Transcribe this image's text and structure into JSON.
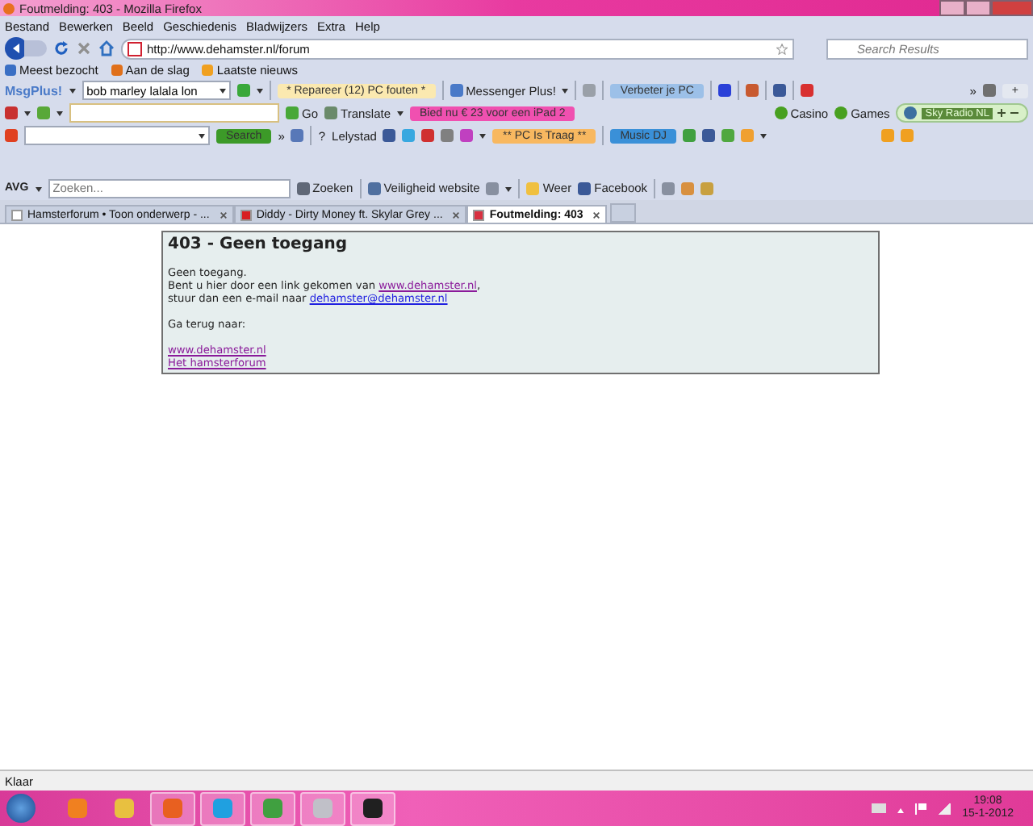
{
  "window": {
    "title": "Foutmelding: 403 - Mozilla Firefox"
  },
  "menu": [
    "Bestand",
    "Bewerken",
    "Beeld",
    "Geschiedenis",
    "Bladwijzers",
    "Extra",
    "Help"
  ],
  "navigation": {
    "url": "http://www.dehamster.nl/forum",
    "search_placeholder": "Search Results"
  },
  "bookmarks": [
    {
      "label": "Meest bezocht",
      "color": "#3a6fc4"
    },
    {
      "label": "Aan de slag",
      "color": "#e0701a"
    },
    {
      "label": "Laatste nieuws",
      "color": "#f0a020"
    }
  ],
  "toolbars": [
    {
      "left": [
        {
          "kind": "logo",
          "label": "MsgPlus!"
        },
        {
          "kind": "caret"
        },
        {
          "kind": "field",
          "value": "bob marley lalala lon",
          "dropdown": true
        },
        {
          "kind": "icon",
          "color": "#3aa83a"
        },
        {
          "kind": "caret"
        },
        {
          "kind": "separator"
        },
        {
          "kind": "promo",
          "label": "* Repareer (12) PC fouten *",
          "color": "#fbe9b0"
        },
        {
          "kind": "separator"
        },
        {
          "kind": "label",
          "label": "Messenger Plus!",
          "color": "#4a7ac8"
        },
        {
          "kind": "caret"
        },
        {
          "kind": "separator"
        },
        {
          "kind": "icon",
          "color": "#9aa0a8"
        },
        {
          "kind": "separator"
        },
        {
          "kind": "promo",
          "label": "Verbeter je PC",
          "color": "#9cc0e8"
        },
        {
          "kind": "separator"
        },
        {
          "kind": "icon",
          "color": "#2a40d8"
        },
        {
          "kind": "separator"
        },
        {
          "kind": "icon",
          "color": "#c85a30"
        },
        {
          "kind": "separator"
        },
        {
          "kind": "icon",
          "color": "#3b5998"
        },
        {
          "kind": "separator"
        },
        {
          "kind": "icon",
          "color": "#d83030"
        }
      ],
      "right": [
        {
          "kind": "label",
          "label": "»"
        },
        {
          "kind": "icon",
          "color": "#707070"
        },
        {
          "kind": "promo",
          "label": "+",
          "color": "#e4e8f0"
        }
      ]
    },
    {
      "left": [
        {
          "kind": "icon",
          "color": "#c83030"
        },
        {
          "kind": "caret"
        },
        {
          "kind": "icon",
          "color": "#58a838"
        },
        {
          "kind": "caret"
        },
        {
          "kind": "field"
        },
        {
          "kind": "label",
          "label": "Go",
          "color": "#48a838"
        },
        {
          "kind": "label",
          "label": "Translate",
          "color": "#6a8a6a"
        },
        {
          "kind": "caret"
        },
        {
          "kind": "promo",
          "label": "Bied nu € 23 voor een iPad 2",
          "color": "#f050b0"
        }
      ],
      "right": [
        {
          "kind": "label",
          "label": "Casino",
          "color": "#48a020"
        },
        {
          "kind": "label",
          "label": "Games",
          "color": "#48a020"
        },
        {
          "kind": "radio",
          "label": "Sky Radio NL"
        }
      ]
    },
    {
      "left": [
        {
          "kind": "icon",
          "color": "#e04020"
        },
        {
          "kind": "field",
          "dropdown": true
        },
        {
          "kind": "promo",
          "label": "Search",
          "color": "#3c9a28"
        },
        {
          "kind": "label",
          "label": "»"
        },
        {
          "kind": "icon",
          "color": "#5878b8"
        },
        {
          "kind": "separator"
        },
        {
          "kind": "label",
          "label": "?"
        },
        {
          "kind": "label",
          "label": "Lelystad"
        },
        {
          "kind": "icon",
          "color": "#3b5998"
        },
        {
          "kind": "icon",
          "color": "#38a8e0"
        },
        {
          "kind": "icon",
          "color": "#d03030"
        },
        {
          "kind": "icon",
          "color": "#808080"
        },
        {
          "kind": "icon",
          "color": "#c040c0"
        },
        {
          "kind": "caret"
        },
        {
          "kind": "promo",
          "label": "** PC Is Traag **",
          "color": "#f8b860"
        },
        {
          "kind": "separator"
        },
        {
          "kind": "promo",
          "label": "Music DJ",
          "color": "#3a90d8"
        },
        {
          "kind": "icon",
          "color": "#40a040"
        },
        {
          "kind": "icon",
          "color": "#3b5998"
        },
        {
          "kind": "icon",
          "color": "#50a840"
        },
        {
          "kind": "icon",
          "color": "#f0a030"
        },
        {
          "kind": "caret"
        }
      ],
      "right": [
        {
          "kind": "icon",
          "color": "#f0a020"
        },
        {
          "kind": "icon",
          "color": "#f0a020"
        }
      ]
    },
    {
      "left": [
        {
          "kind": "logo",
          "label": "AVG"
        },
        {
          "kind": "caret"
        },
        {
          "kind": "field",
          "placeholder": "Zoeken..."
        },
        {
          "kind": "label",
          "label": "Zoeken",
          "color": "#606878"
        },
        {
          "kind": "separator"
        },
        {
          "kind": "label",
          "label": "Veiligheid website",
          "color": "#5070a0"
        },
        {
          "kind": "icon",
          "color": "#8890a0"
        },
        {
          "kind": "caret"
        },
        {
          "kind": "separator"
        },
        {
          "kind": "label",
          "label": "Weer",
          "color": "#f0c040"
        },
        {
          "kind": "label",
          "label": "Facebook",
          "color": "#3b5998"
        },
        {
          "kind": "separator"
        },
        {
          "kind": "icon",
          "color": "#8890a0"
        },
        {
          "kind": "icon",
          "color": "#d89040"
        },
        {
          "kind": "icon",
          "color": "#c8a040"
        }
      ]
    }
  ],
  "tabs": [
    {
      "label": "Hamsterforum • Toon onderwerp - ...",
      "selected": false,
      "color": "#ffffff"
    },
    {
      "label": "Diddy - Dirty Money ft. Skylar Grey ...",
      "selected": false,
      "color": "#d82020"
    },
    {
      "label": "Foutmelding: 403",
      "selected": true,
      "color": "#d83040"
    }
  ],
  "page": {
    "heading": "403 - Geen toegang",
    "lines": [
      [
        {
          "text": "Geen toegang."
        }
      ],
      [
        {
          "text": "Bent u hier door een link gekomen van "
        },
        {
          "text": "www.dehamster.nl",
          "link": true,
          "visited": true
        },
        {
          "text": ","
        }
      ],
      [
        {
          "text": "stuur dan een e-mail naar "
        },
        {
          "text": "dehamster@dehamster.nl",
          "link": true,
          "visited": false
        }
      ]
    ],
    "back_label": "Ga terug naar:",
    "back_links": [
      {
        "text": "www.dehamster.nl",
        "visited": true
      },
      {
        "text": "Het hamsterforum",
        "visited": true
      }
    ]
  },
  "status_bar": "Klaar",
  "taskbar": {
    "items": [
      {
        "color": "#f08020",
        "open": false
      },
      {
        "color": "#e8c040",
        "open": false
      },
      {
        "color": "#e86020",
        "open": true
      },
      {
        "color": "#20a0e0",
        "open": true
      },
      {
        "color": "#40a040",
        "open": true
      },
      {
        "color": "#c0c0c8",
        "open": true
      },
      {
        "color": "#202020",
        "open": true
      }
    ],
    "time": "19:08",
    "date": "15-1-2012"
  }
}
